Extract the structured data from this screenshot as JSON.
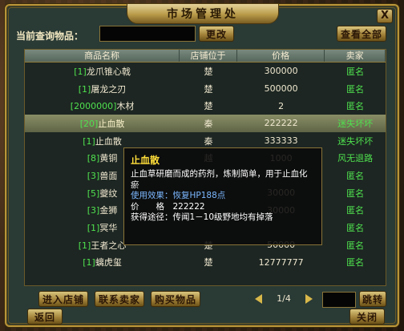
{
  "window": {
    "title": "市场管理处",
    "close_label": "X"
  },
  "query": {
    "label": "当前查询物品：",
    "value": "",
    "change_button": "更改",
    "view_all_button": "查看全部"
  },
  "table": {
    "headers": [
      "商品名称",
      "店铺位于",
      "价格",
      "卖家"
    ],
    "rows": [
      {
        "level": "[1]",
        "name": "龙爪锥心戟",
        "location": "楚",
        "price": "300000",
        "seller": "匿名"
      },
      {
        "level": "[1]",
        "name": "屠龙之刃",
        "location": "楚",
        "price": "500000",
        "seller": "匿名"
      },
      {
        "level": "[2000000]",
        "name": "木材",
        "location": "楚",
        "price": "2",
        "seller": "匿名"
      },
      {
        "level": "[20]",
        "name": "止血散",
        "location": "秦",
        "price": "222222",
        "seller": "迷失坏坏"
      },
      {
        "level": "[1]",
        "name": "止血散",
        "location": "秦",
        "price": "333333",
        "seller": "迷失坏坏"
      },
      {
        "level": "[8]",
        "name": "黄铜",
        "location": "越",
        "price": "1000",
        "seller": "风无退路"
      },
      {
        "level": "[3]",
        "name": "兽面",
        "location": "",
        "price": "",
        "seller": "匿名"
      },
      {
        "level": "[5]",
        "name": "夔纹",
        "location": "",
        "price": "30000",
        "seller": "匿名"
      },
      {
        "level": "[3]",
        "name": "金狮",
        "location": "",
        "price": "30000",
        "seller": "匿名"
      },
      {
        "level": "[1]",
        "name": "冥华",
        "location": "",
        "price": "",
        "seller": "匿名"
      },
      {
        "level": "[1]",
        "name": "王者之心",
        "location": "楚",
        "price": "50000",
        "seller": "匿名"
      },
      {
        "level": "[1]",
        "name": "螭虎玺",
        "location": "楚",
        "price": "12777777",
        "seller": "匿名"
      }
    ]
  },
  "tooltip": {
    "name": "止血散",
    "description": "止血草研磨而成的药剂，炼制简单，用于止血化瘀",
    "effect": "使用效果：恢复HP188点",
    "price": "价　　格　222222",
    "source": "获得途径：传闻1－10级野地均有掉落"
  },
  "footer": {
    "enter_shop": "进入店铺",
    "contact_seller": "联系卖家",
    "buy_item": "购买物品",
    "page": "1/4",
    "jump": "跳转",
    "back": "返回",
    "close": "关闭"
  }
}
